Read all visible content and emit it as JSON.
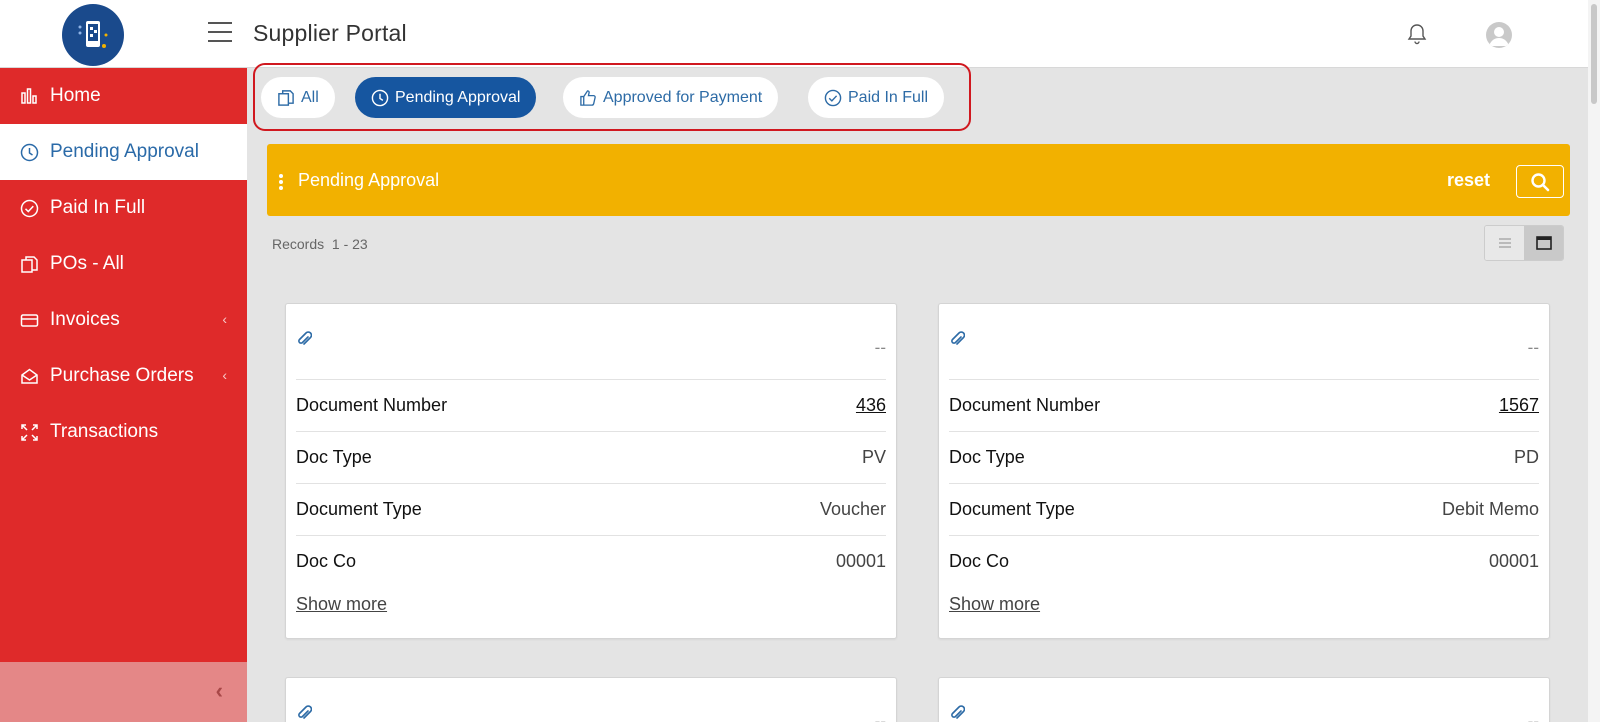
{
  "header": {
    "title": "Supplier Portal"
  },
  "sidebar": {
    "items": [
      {
        "label": "Home",
        "icon": "bar-chart-icon"
      },
      {
        "label": "Pending Approval",
        "icon": "clock-icon"
      },
      {
        "label": "Paid In Full",
        "icon": "check-circle-icon"
      },
      {
        "label": "POs - All",
        "icon": "documents-icon"
      },
      {
        "label": "Invoices",
        "icon": "credit-card-icon"
      },
      {
        "label": "Purchase Orders",
        "icon": "envelope-open-icon"
      },
      {
        "label": "Transactions",
        "icon": "expand-arrows-icon"
      }
    ]
  },
  "filters": {
    "all": "All",
    "pending": "Pending Approval",
    "approved": "Approved for Payment",
    "paid": "Paid In Full"
  },
  "section": {
    "title": "Pending Approval",
    "reset": "reset"
  },
  "records": {
    "label": "Records",
    "range": "1 - 23"
  },
  "cards": [
    {
      "status": "--",
      "document_number_label": "Document Number",
      "document_number": "436",
      "doc_type_label": "Doc Type",
      "doc_type": "PV",
      "document_type_label": "Document Type",
      "document_type": "Voucher",
      "doc_co_label": "Doc Co",
      "doc_co": "00001",
      "show_more": "Show more"
    },
    {
      "status": "--",
      "document_number_label": "Document Number",
      "document_number": "1567",
      "doc_type_label": "Doc Type",
      "doc_type": "PD",
      "document_type_label": "Document Type",
      "document_type": "Debit Memo",
      "doc_co_label": "Doc Co",
      "doc_co": "00001",
      "show_more": "Show more"
    },
    {
      "status": "--"
    },
    {
      "status": "--"
    }
  ],
  "colors": {
    "sidebar": "#df2a2a",
    "accent_blue": "#1656a0",
    "section_bar": "#f2b100",
    "highlight_border": "#d0181f"
  }
}
